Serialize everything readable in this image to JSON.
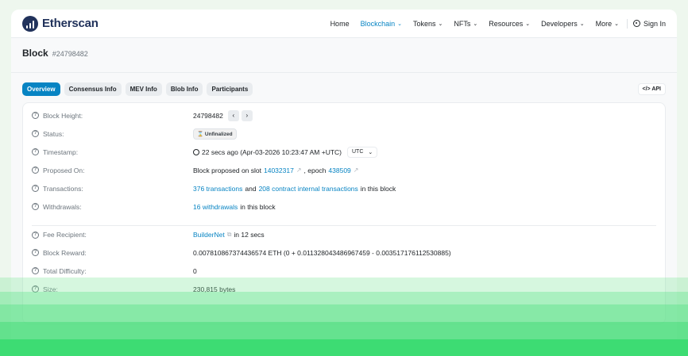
{
  "header": {
    "logo_text": "Etherscan",
    "nav": [
      {
        "label": "Home",
        "active": false,
        "dropdown": false
      },
      {
        "label": "Blockchain",
        "active": true,
        "dropdown": true
      },
      {
        "label": "Tokens",
        "active": false,
        "dropdown": true
      },
      {
        "label": "NFTs",
        "active": false,
        "dropdown": true
      },
      {
        "label": "Resources",
        "active": false,
        "dropdown": true
      },
      {
        "label": "Developers",
        "active": false,
        "dropdown": true
      },
      {
        "label": "More",
        "active": false,
        "dropdown": true
      }
    ],
    "signin_label": "Sign In"
  },
  "page": {
    "title": "Block",
    "block_number": "#24798482"
  },
  "tabs": [
    "Overview",
    "Consensus Info",
    "MEV Info",
    "Blob Info",
    "Participants"
  ],
  "api_label": "API",
  "fields": {
    "block_height": {
      "label": "Block Height:",
      "value": "24798482"
    },
    "status": {
      "label": "Status:",
      "value": "Unfinalized"
    },
    "timestamp": {
      "label": "Timestamp:",
      "value": "22 secs ago (Apr-03-2026 10:23:47 AM +UTC)",
      "tz": "UTC"
    },
    "proposed_on": {
      "label": "Proposed On:",
      "prefix": "Block proposed on slot",
      "slot": "14032317",
      "mid": ", epoch",
      "epoch": "438509"
    },
    "transactions": {
      "label": "Transactions:",
      "tx_link": "376 transactions",
      "and": "and",
      "internal_link": "208 contract internal transactions",
      "suffix": "in this block"
    },
    "withdrawals": {
      "label": "Withdrawals:",
      "link": "16 withdrawals",
      "suffix": "in this block"
    },
    "fee_recipient": {
      "label": "Fee Recipient:",
      "link": "BuilderNet",
      "suffix": "in 12 secs"
    },
    "block_reward": {
      "label": "Block Reward:",
      "value": "0.007810867374436574 ETH (0 + 0.011328043486967459 - 0.003517176112530885)"
    },
    "total_difficulty": {
      "label": "Total Difficulty:",
      "value": "0"
    },
    "size": {
      "label": "Size:",
      "value": "230,815 bytes"
    }
  },
  "colors": {
    "accent": "#0784c3",
    "overlay_green": "#3ddc73"
  }
}
